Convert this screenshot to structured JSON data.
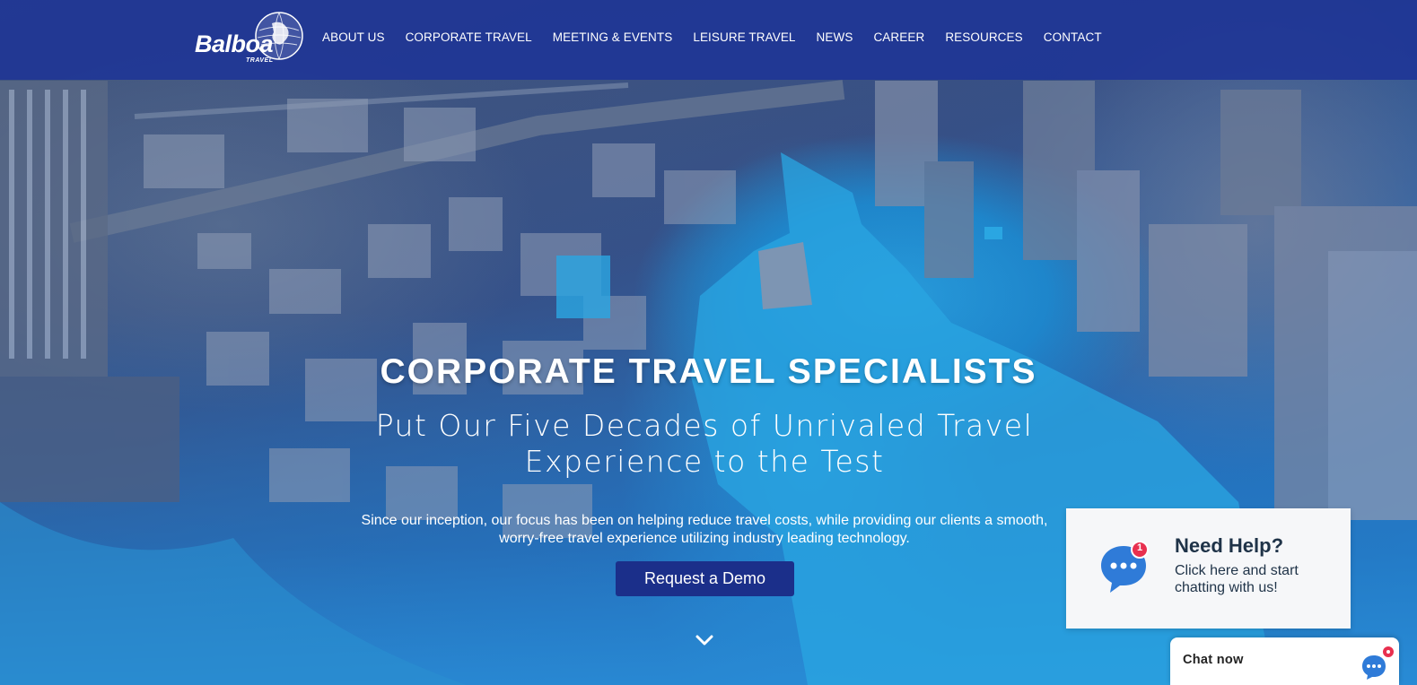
{
  "brand": {
    "logo_word": "Balboa",
    "logo_sub": "TRAVEL"
  },
  "nav": {
    "items": [
      {
        "label": "ABOUT US"
      },
      {
        "label": "CORPORATE TRAVEL"
      },
      {
        "label": "MEETING & EVENTS"
      },
      {
        "label": "LEISURE TRAVEL"
      },
      {
        "label": "NEWS"
      },
      {
        "label": "CAREER"
      },
      {
        "label": "RESOURCES"
      },
      {
        "label": "CONTACT"
      }
    ]
  },
  "hero": {
    "title": "CORPORATE TRAVEL SPECIALISTS",
    "subtitle": "Put Our Five Decades of Unrivaled Travel Experience to the Test",
    "description": "Since our inception, our focus has been on helping reduce travel costs, while providing our clients a smooth, worry-free travel experience utilizing industry leading technology.",
    "cta_label": "Request a Demo",
    "scroll_icon": "chevron-down-icon"
  },
  "help_widget": {
    "title": "Need Help?",
    "text": "Click here and start chatting with us!",
    "badge_count": "1",
    "icon": "chat-bubble-icon"
  },
  "chat_bar": {
    "label": "Chat now",
    "icon": "chat-bubble-icon"
  },
  "colors": {
    "header_bg": "#1e3496",
    "button_bg": "#1b2f8a",
    "badge": "#e8304f",
    "chat_icon": "#2f7bd8"
  }
}
